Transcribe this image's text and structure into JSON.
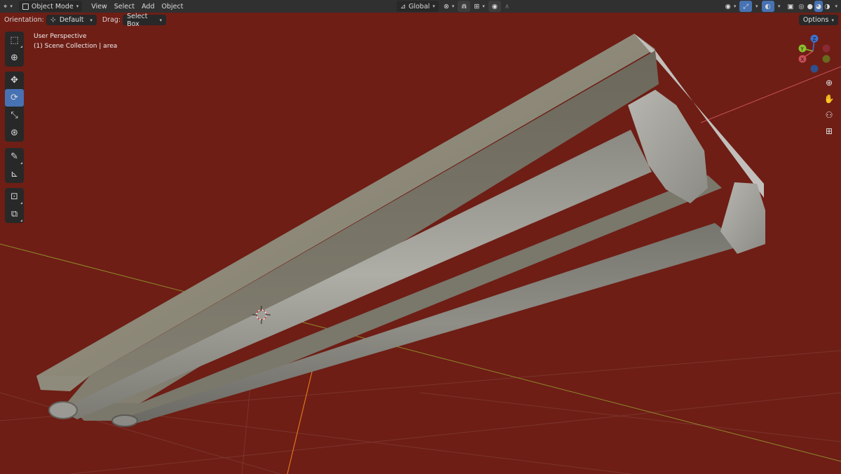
{
  "header": {
    "editor_icon": "3d-viewport-icon",
    "mode": "Object Mode",
    "menus": [
      "View",
      "Select",
      "Add",
      "Object"
    ],
    "transform_orientation": "Global",
    "pivot_icon": "pivot-icon",
    "snap_icon": "magnet-icon",
    "proportional_icon": "proportional-edit-icon",
    "visibility_icon": "eye-icon",
    "gizmo_icon": "gizmo-icon",
    "overlay_icon": "overlay-icon",
    "xray_icon": "xray-icon",
    "shading_modes": [
      "wireframe",
      "solid",
      "material-preview",
      "rendered"
    ]
  },
  "tool_header": {
    "orientation_label": "Orientation:",
    "orientation_value": "Default",
    "drag_label": "Drag:",
    "drag_value": "Select Box",
    "options_label": "Options"
  },
  "toolbar": {
    "tools": [
      "select-box",
      "cursor",
      "move",
      "rotate",
      "scale",
      "transform",
      "annotate",
      "measure",
      "add-cube",
      "scale-cage"
    ],
    "active_tool": "rotate"
  },
  "viewport": {
    "view_name": "User Perspective",
    "collection_info": "(1) Scene Collection | area",
    "background_color": "#6e1e15"
  },
  "navigation_gizmo": {
    "axes": [
      "Z",
      "Y",
      "X"
    ],
    "x_color": "#c94d55",
    "y_color": "#8bbf2f",
    "z_color": "#3d72cf"
  }
}
